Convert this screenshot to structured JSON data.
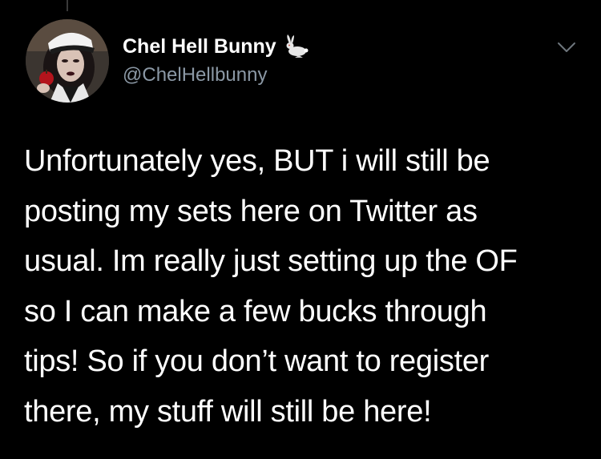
{
  "tweet": {
    "author": {
      "display_name": "Chel Hell Bunny",
      "handle": "@ChelHellbunny",
      "name_emoji": "rabbit-icon"
    },
    "menu_icon": "chevron-down-icon",
    "body_lines": [
      "Unfortunately yes, BUT i will still be",
      "posting my sets here on Twitter as",
      "usual. Im really just setting up the OF",
      "so I can make a few bucks through",
      "tips! So if you don’t want to register",
      "there, my stuff will still be here!"
    ]
  },
  "colors": {
    "background": "#000000",
    "text_primary": "#ffffff",
    "text_secondary": "#8b98a5"
  }
}
